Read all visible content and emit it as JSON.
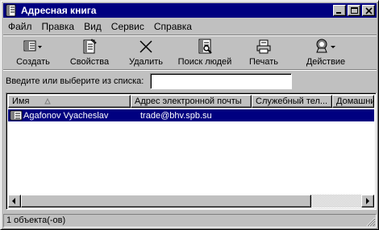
{
  "window": {
    "title": "Адресная книга"
  },
  "menu": [
    {
      "label": "Файл",
      "key": "Ф"
    },
    {
      "label": "Правка",
      "key": "П"
    },
    {
      "label": "Вид",
      "key": "В"
    },
    {
      "label": "Сервис",
      "key": "С"
    },
    {
      "label": "Справка",
      "key": "С"
    }
  ],
  "toolbar": {
    "create": "Создать",
    "properties": "Свойства",
    "delete": "Удалить",
    "find": "Поиск людей",
    "print": "Печать",
    "action": "Действие"
  },
  "search": {
    "label": "Введите или выберите из списка:",
    "value": ""
  },
  "columns": [
    "Имя",
    "Адрес электронной почты",
    "Служебный тел...",
    "Домашни"
  ],
  "rows": [
    {
      "name": "Agafonov Vyacheslav",
      "email": "trade@bhv.spb.su",
      "work_phone": "",
      "home_phone": ""
    }
  ],
  "status": {
    "text": "1 объекта(-ов)"
  },
  "colors": {
    "title_bg": "#000080",
    "selection": "#000080",
    "face": "#c0c0c0"
  }
}
